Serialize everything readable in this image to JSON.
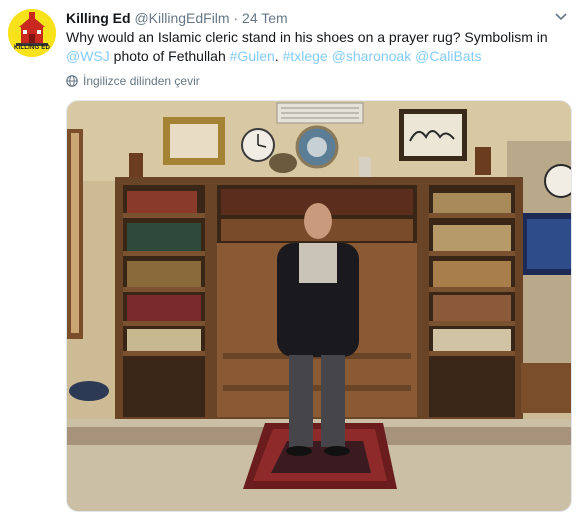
{
  "tweet": {
    "author_name": "Killing Ed",
    "handle": "@KillingEdFilm",
    "separator": "·",
    "date": "24 Tem",
    "text_before": "Why would an Islamic cleric stand in his shoes on a prayer rug? Symbolism in ",
    "mention_wsj": "@WSJ",
    "text_mid": " photo of Fethullah ",
    "hashtag_gulen": "#Gulen",
    "text_after": ". ",
    "hashtag_txlege": "#txlege",
    "mention_sharon": "@sharonoak",
    "mention_cali": "@CaliBats",
    "translate_label": "İngilizce dilinden çevir"
  },
  "avatar": {
    "label": "KILLING ED"
  },
  "icons": {
    "caret": "chevron-down-icon",
    "globe": "globe-icon"
  },
  "colors": {
    "link": "#1da1f2",
    "text": "#14171a",
    "secondary": "#657786",
    "avatar_bg": "#f7e21b"
  }
}
